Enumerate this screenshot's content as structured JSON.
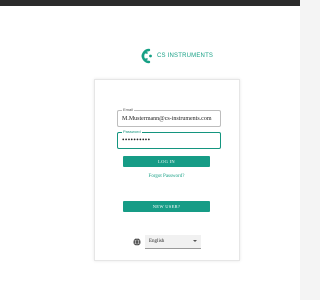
{
  "brand": {
    "name": "CS INSTRUMENTS",
    "accent_color": "#16a085"
  },
  "login": {
    "email_label": "Email",
    "email_value": "M.Mustermann@cs-instruments.com",
    "password_label": "Password",
    "password_value": "••••••••••",
    "login_button": "LOG IN",
    "forgot_password_link": "Forgot Password?",
    "new_user_button": "NEW USER?"
  },
  "language": {
    "selected": "English",
    "icon": "globe-icon"
  }
}
